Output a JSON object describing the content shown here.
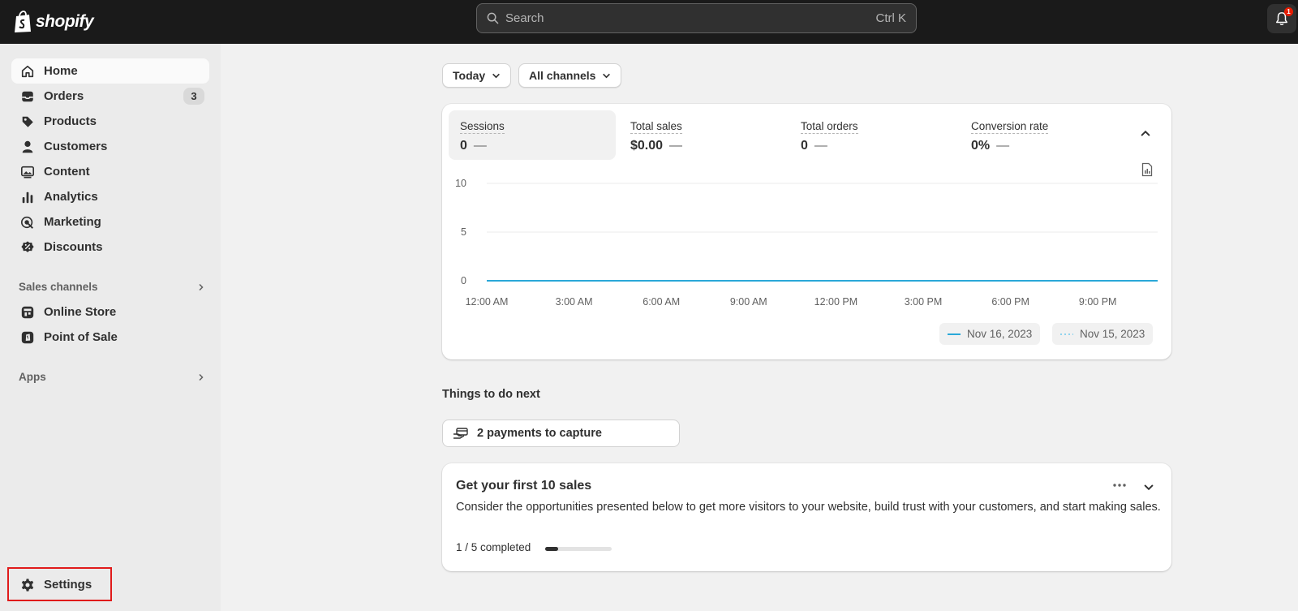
{
  "topbar": {
    "brand": "shopify",
    "search_placeholder": "Search",
    "search_shortcut": "Ctrl K",
    "notification_count": "1"
  },
  "sidebar": {
    "items": [
      {
        "label": "Home",
        "icon": "home-icon"
      },
      {
        "label": "Orders",
        "icon": "inbox-icon",
        "badge": "3"
      },
      {
        "label": "Products",
        "icon": "tag-icon"
      },
      {
        "label": "Customers",
        "icon": "person-icon"
      },
      {
        "label": "Content",
        "icon": "image-icon"
      },
      {
        "label": "Analytics",
        "icon": "bar-chart-icon"
      },
      {
        "label": "Marketing",
        "icon": "target-icon"
      },
      {
        "label": "Discounts",
        "icon": "discount-icon"
      }
    ],
    "sales_channels_label": "Sales channels",
    "channels": [
      {
        "label": "Online Store",
        "icon": "store-icon"
      },
      {
        "label": "Point of Sale",
        "icon": "pos-icon"
      }
    ],
    "apps_label": "Apps",
    "settings_label": "Settings"
  },
  "filters": {
    "date": "Today",
    "channels": "All channels"
  },
  "metrics": [
    {
      "label": "Sessions",
      "value": "0",
      "change": "—"
    },
    {
      "label": "Total sales",
      "value": "$0.00",
      "change": "—"
    },
    {
      "label": "Total orders",
      "value": "0",
      "change": "—"
    },
    {
      "label": "Conversion rate",
      "value": "0%",
      "change": "—"
    }
  ],
  "chart_data": {
    "type": "line",
    "x": [
      "12:00 AM",
      "3:00 AM",
      "6:00 AM",
      "9:00 AM",
      "12:00 PM",
      "3:00 PM",
      "6:00 PM",
      "9:00 PM"
    ],
    "yticks": [
      "10",
      "5",
      "0"
    ],
    "ylim": [
      0,
      10
    ],
    "series": [
      {
        "name": "Nov 16, 2023",
        "values": [
          0,
          0,
          0,
          0,
          0,
          0,
          0,
          0
        ],
        "color": "#2aa8d8",
        "style": "solid"
      },
      {
        "name": "Nov 15, 2023",
        "values": [
          0,
          0,
          0,
          0,
          0,
          0,
          0,
          0
        ],
        "color": "#8fd3ee",
        "style": "dotted"
      }
    ],
    "grid": true,
    "legend": "bottom-right"
  },
  "next": {
    "title": "Things to do next",
    "task": "2 payments to capture"
  },
  "sales_card": {
    "title": "Get your first 10 sales",
    "description": "Consider the opportunities presented below to get more visitors to your website, build trust with your customers, and start making sales.",
    "progress_text": "1 / 5 completed",
    "progress": 0.2
  },
  "colors": {
    "topbar": "#1a1a1a",
    "accent_line": "#2aa8d8",
    "highlight_border": "#e01b1b"
  }
}
